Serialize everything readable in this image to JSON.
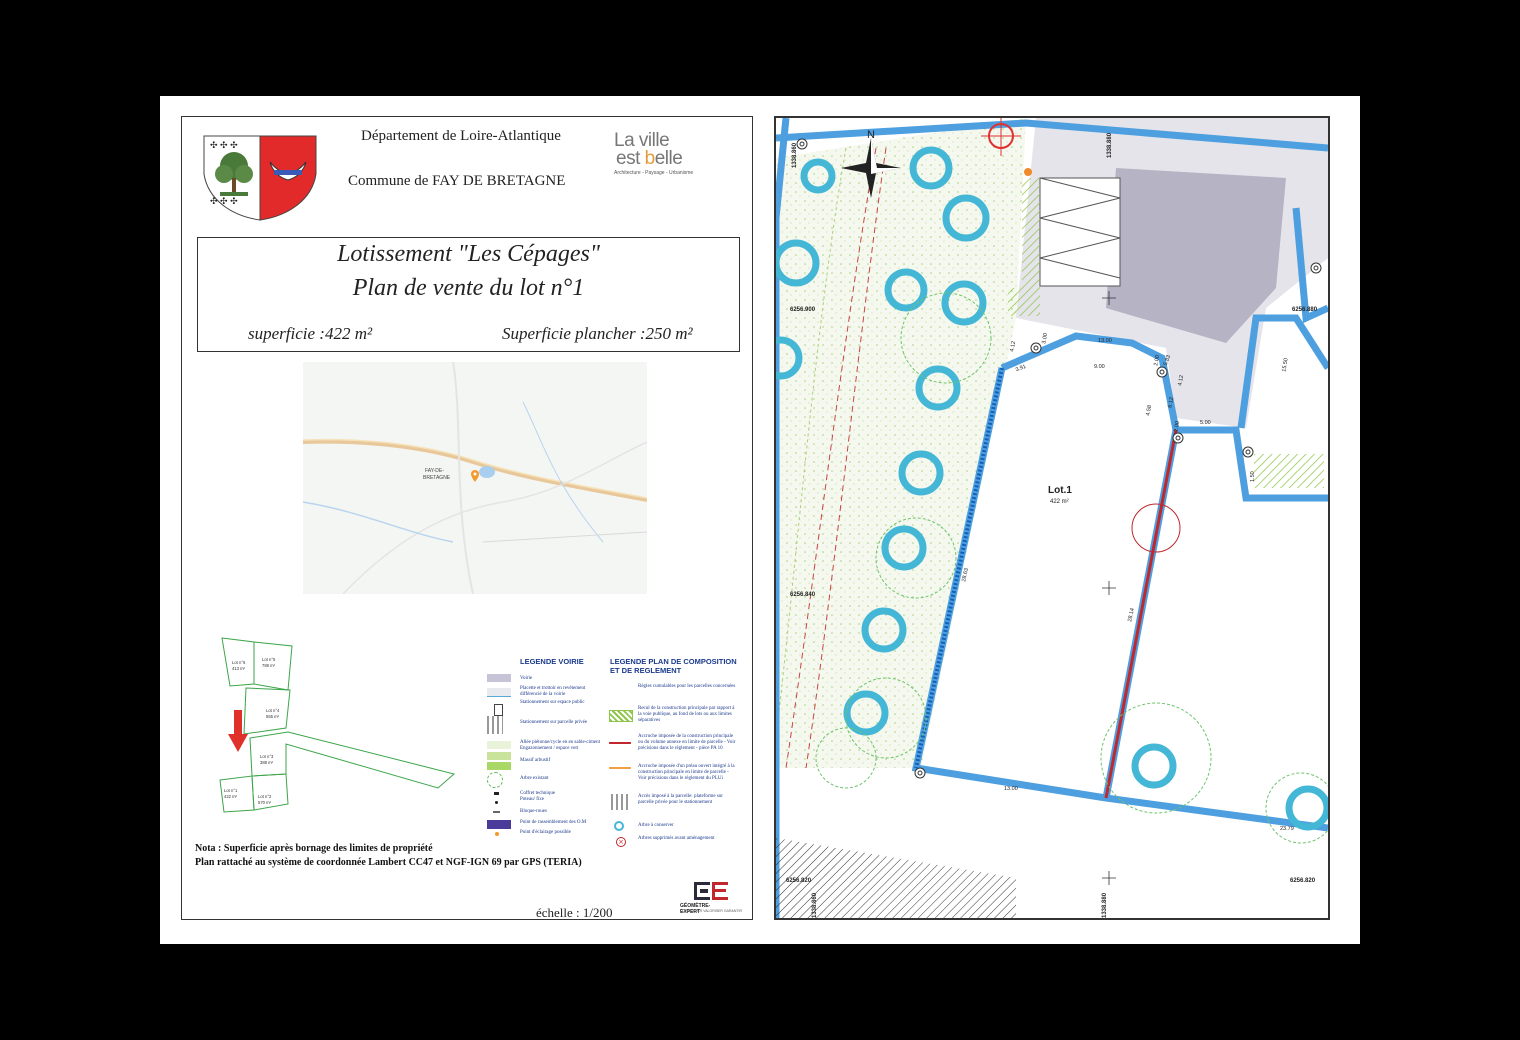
{
  "header": {
    "department": "Département de Loire-Atlantique",
    "commune": "Commune de FAY DE BRETAGNE",
    "brand_line1": "La ville",
    "brand_line2a": "est ",
    "brand_line2b": "b",
    "brand_line2c": "elle",
    "brand_tagline": "Architecture - Paysage - Urbanisme"
  },
  "title": {
    "line1": "Lotissement \"Les Cépages\"",
    "line2": "Plan de vente du lot n°1",
    "area": "superficie :422 m²",
    "floor_area": "Superficie plancher  :250 m²"
  },
  "location_map": {
    "town_label_1": "FAY-DE-",
    "town_label_2": "BRETAGNE",
    "marker_color": "#f39a2b"
  },
  "mini_plan": {
    "lots": [
      {
        "label": "Lot n°6",
        "area": "413 m²"
      },
      {
        "label": "Lot n°5",
        "area": "788 m²"
      },
      {
        "label": "Lot n°4",
        "area": "555 m²"
      },
      {
        "label": "Lot n°3",
        "area": "388 m²"
      },
      {
        "label": "Lot n°1",
        "area": "422 m²"
      },
      {
        "label": "Lot n°2",
        "area": "570 m²"
      }
    ]
  },
  "legend_voirie": {
    "title": "LEGENDE VOIRIE",
    "items": [
      "Voirie",
      "Placette et trottoir en revêtement différencié de la voirie",
      "Stationnement sur espace public",
      "Stationnement sur parcelle privée",
      "Allée piétonne/cycle en en sable-ciment",
      "Engazonnement / espace vert",
      "Massif arbustif",
      "Arbre existant",
      "Coffret technique",
      "Poteau/ fixe",
      "Bloque-roues",
      "Point de rassemblement des O.M",
      "Point d'éclairage possible"
    ]
  },
  "legend_composition": {
    "title_line1": "LEGENDE PLAN DE COMPOSITION",
    "title_line2": "ET DE REGLEMENT",
    "items": [
      "Règles cumulables pour les parcelles concernées",
      "Recul de la construction principale par rapport à la voie publique, au fond de lots ou aux limites séparatives",
      "Accroche imposée de la construction principale ou du volume annexe en limite de parcelle - Voir précisions dans le règlement - pièce PA 10",
      "Accroche imposée d'un préau ouvert intégré à la construction principale en limite de parcelle - Voir précisions dans le règlement du PLUi",
      "Accès imposé à la parcelle: plateforme sur parcelle privée pour le stationnement",
      "Arbre à conserver",
      "Arbres supprimés avant aménagement"
    ]
  },
  "notes": {
    "nota": "Nota : Superficie après bornage des limites de propriété",
    "systeme": "Plan rattaché au système de coordonnée Lambert CC47 et NGF-IGN 69 par GPS (TERIA)"
  },
  "scale": "échelle : 1/200",
  "surveyor": {
    "name": "GÉOMÈTRE-EXPERT",
    "subtitle": "CONSEILLER VALORISER GARANTIR"
  },
  "plan": {
    "north": "N",
    "lot_label": "Lot.1",
    "lot_area": "422 m²",
    "coords": [
      "1338.860",
      "1338.880",
      "6256.900",
      "6256.880",
      "6256.840",
      "6256.820",
      "1338.860",
      "1338.880",
      "6256.820"
    ],
    "dims": [
      "13.00",
      "4.12",
      "3.00",
      "3.91",
      "9.00",
      "2.00",
      "5.83",
      "4.12",
      "6.12",
      "4.58",
      "2.00",
      "5.00",
      "15.50",
      "1.50",
      "28.63",
      "28.14",
      "13.00",
      "23.79"
    ],
    "colors": {
      "boundary": "#4d9fe0",
      "tree": "#45b7d6",
      "accroche": "#c0282d",
      "voirie": "#bab8c8",
      "greenway": "#f2f5ea"
    }
  }
}
